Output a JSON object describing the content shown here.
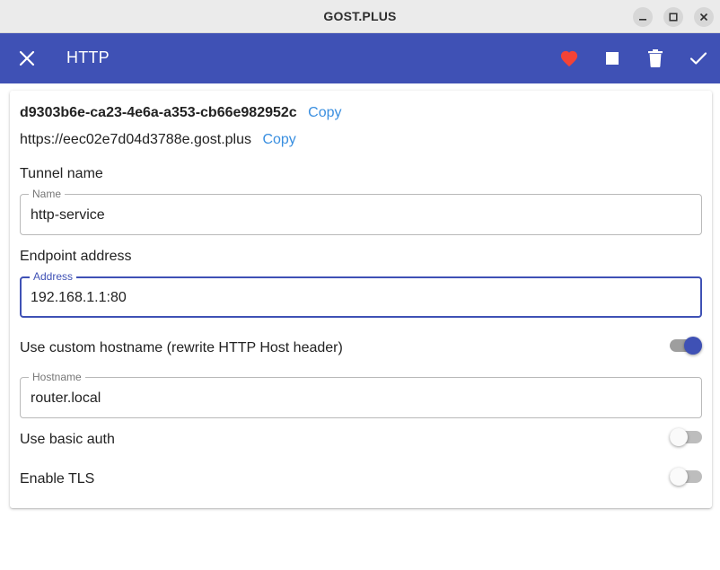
{
  "window": {
    "title": "GOST.PLUS"
  },
  "appbar": {
    "title": "HTTP",
    "color": "#3f51b5",
    "actions": [
      "close-icon",
      "heart-icon",
      "stop-icon",
      "trash-icon",
      "check-icon"
    ],
    "favorite_color": "#f44336"
  },
  "tunnel": {
    "id": "d9303b6e-ca23-4e6a-a353-cb66e982952c",
    "url": "https://eec02e7d04d3788e.gost.plus",
    "copy_label": "Copy"
  },
  "form": {
    "tunnel_name": {
      "section": "Tunnel name",
      "legend": "Name",
      "value": "http-service"
    },
    "endpoint": {
      "section": "Endpoint address",
      "legend": "Address",
      "value": "192.168.1.1:80"
    },
    "custom_hostname": {
      "label": "Use custom hostname (rewrite HTTP Host header)",
      "enabled": true,
      "legend": "Hostname",
      "value": "router.local"
    },
    "basic_auth": {
      "label": "Use basic auth",
      "enabled": false
    },
    "tls": {
      "label": "Enable TLS",
      "enabled": false
    }
  }
}
